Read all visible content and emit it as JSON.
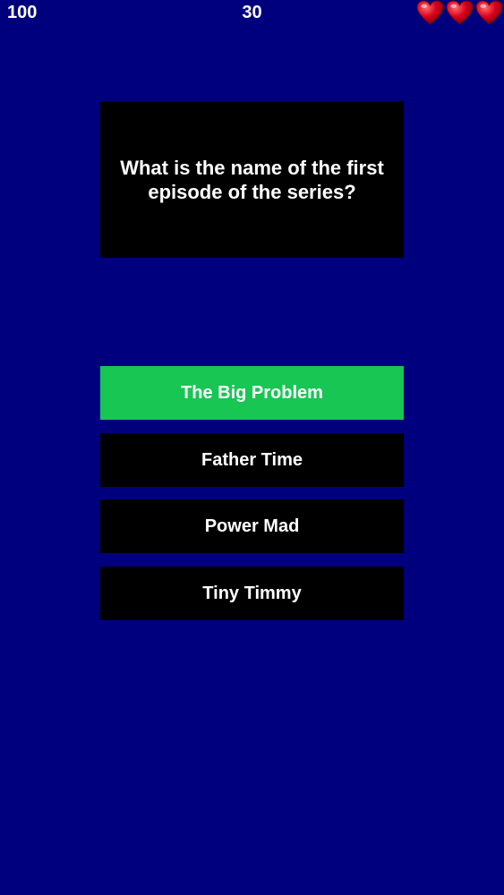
{
  "hud": {
    "score": "100",
    "timer": "30",
    "lives": 3,
    "heart_icon": "heart-icon",
    "heart_color": "#d8001c"
  },
  "question": {
    "text": "What is the name of the first episode of the series?"
  },
  "answers": [
    {
      "label": "The Big Problem",
      "state": "correct"
    },
    {
      "label": "Father Time",
      "state": "default"
    },
    {
      "label": "Power Mad",
      "state": "default"
    },
    {
      "label": "Tiny Timmy",
      "state": "default"
    }
  ],
  "colors": {
    "background": "#00007f",
    "panel": "#000000",
    "correct": "#17c653",
    "text": "#ffffff"
  }
}
